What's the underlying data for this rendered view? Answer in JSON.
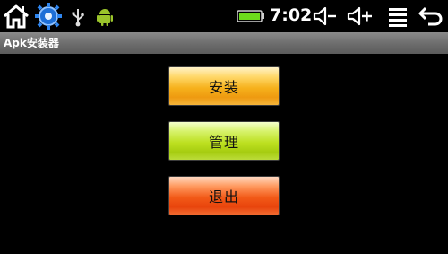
{
  "status_bar": {
    "time": "7:02",
    "icons": [
      "home-icon",
      "settings-gear-icon",
      "usb-icon",
      "android-debug-icon",
      "battery-icon",
      "volume-down-icon",
      "volume-up-icon",
      "menu-icon",
      "back-icon"
    ],
    "battery_color": "#6ddc1c"
  },
  "app": {
    "title": "Apk安装器"
  },
  "buttons": {
    "install": "安装",
    "manage": "管理",
    "exit": "退出"
  },
  "colors": {
    "install": "#f6b11c",
    "manage": "#bde020",
    "exit": "#f25a18"
  }
}
